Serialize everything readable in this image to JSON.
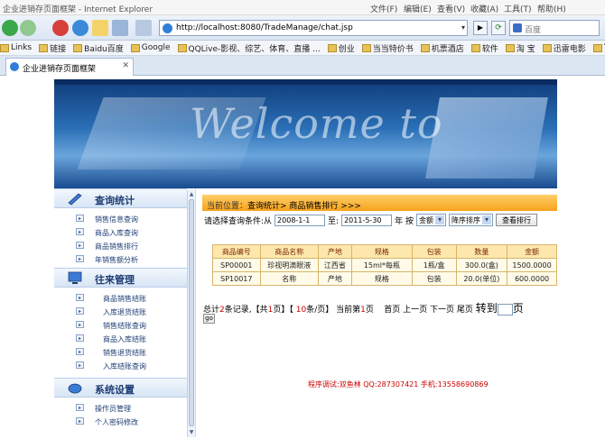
{
  "window": {
    "title": "企业进销存页面框架 - Internet Explorer"
  },
  "menu": [
    "文件(F)",
    "编辑(E)",
    "查看(V)",
    "收藏(A)",
    "工具(T)",
    "帮助(H)"
  ],
  "address": {
    "url": "http://localhost:8080/TradeManage/chat.jsp"
  },
  "search": {
    "placeholder": "百度"
  },
  "favorites": [
    "Links",
    "链接",
    "Baidu百度",
    "Google",
    "QQLive-影视、综艺、体育、直播 ...",
    "创业",
    "当当特价书",
    "机票酒店",
    "软件",
    "淘 宝",
    "迅雷电影",
    "Y"
  ],
  "tab": {
    "label": "企业进销存页面框架"
  },
  "banner": {
    "text": "Welcome to"
  },
  "sidebar": {
    "sections": [
      {
        "title": "查询统计",
        "items": [
          "销售信息查询",
          "商品入库查询",
          "商品销售排行",
          "年销售额分析"
        ]
      },
      {
        "title": "往来管理",
        "items": [
          "商品销售结账",
          "入库退货结账",
          "销售结账查询",
          "商品入库结账",
          "销售退货结账",
          "入库结账查询"
        ]
      },
      {
        "title": "系统设置",
        "items": [
          "操作员管理",
          "个人密码修改"
        ]
      }
    ]
  },
  "breadcrumb": {
    "prefix": "当前位置：",
    "path": "查询统计> 商品销售排行 >>>"
  },
  "query": {
    "label": "请选择查询条件:从",
    "from": "2008-1-1",
    "to_label": "至:",
    "to": "2011-5-30",
    "by_label": "年 按",
    "field": "金额",
    "order": "降序排序",
    "button": "查看排行"
  },
  "table": {
    "headers": [
      "商品编号",
      "商品名称",
      "产地",
      "规格",
      "包装",
      "数量",
      "金额"
    ],
    "rows": [
      [
        "SP00001",
        "珍视明滴眼液",
        "江西省",
        "15ml*每瓶",
        "1瓶/盒",
        "300.0(盒)",
        "1500.0000"
      ],
      [
        "SP10017",
        "名称",
        "产地",
        "规格",
        "包装",
        "20.0(单位)",
        "600.0000"
      ]
    ]
  },
  "pager": {
    "t1": "总计",
    "total": "2",
    "t2": "条记录,【共",
    "pages": "1",
    "t3": "页】【 ",
    "per": "10",
    "t4": "条/页】 当前第",
    "current": "1",
    "t5": "页",
    "nav": "首页 上一页 下一页 尾页",
    "goto": "转到",
    "goto_unit": "页",
    "go": "go"
  },
  "footer": {
    "text": "程序调试:双鱼林 QQ:287307421 手机:13558690869"
  }
}
